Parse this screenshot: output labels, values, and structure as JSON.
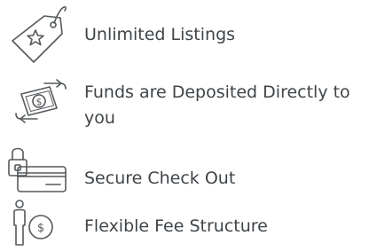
{
  "features": [
    {
      "icon": "price-tag-star-icon",
      "label": "Unlimited Listings"
    },
    {
      "icon": "money-transfer-arrows-icon",
      "label": "Funds are Deposited Directly to you"
    },
    {
      "icon": "padlock-credit-card-icon",
      "label": "Secure Check Out"
    },
    {
      "icon": "person-dollar-coin-icon",
      "label": "Flexible Fee Structure"
    }
  ],
  "colors": {
    "text": "#3f4448",
    "icon_stroke": "#55595c"
  }
}
